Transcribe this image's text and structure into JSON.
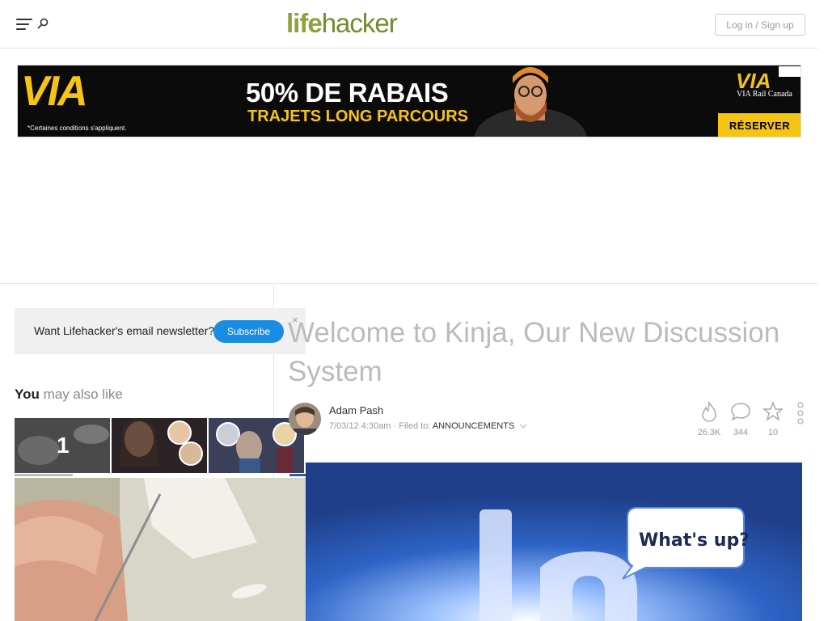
{
  "header": {
    "logo_life": "life",
    "logo_hacker": "hacker",
    "login_label": "Log in / Sign up",
    "icons": [
      "menu-icon",
      "search-icon"
    ]
  },
  "ad": {
    "brand": "VIA",
    "fine_print": "*Certaines conditions s'appliquent.",
    "headline": "50% DE RABAIS",
    "subheadline": "TRAJETS LONG PARCOURS",
    "brand_small": "VIA",
    "rail_text": "VIA Rail Canada",
    "cta": "RÉSERVER",
    "colors": {
      "yellow": "#f6c413",
      "black": "#0b0b0b"
    }
  },
  "newsletter": {
    "text": "Want Lifehacker's email newsletter?",
    "button": "Subscribe",
    "close": "×"
  },
  "recommendations": {
    "heading_strong": "You",
    "heading_rest": " may also like",
    "thumbs": [
      {
        "label": "1"
      },
      {
        "label": ""
      },
      {
        "label": ""
      }
    ]
  },
  "article": {
    "title": "Welcome to Kinja, Our New Discussion System",
    "author": "Adam Pash",
    "date": "7/03/12 4:30am",
    "filed_to_label": "Filed to:",
    "category": "ANNOUNCEMENTS",
    "stats": {
      "views": "26.3K",
      "comments": "344",
      "stars": "10"
    },
    "hero_bubble": "What's up?"
  },
  "colors": {
    "accent_blue": "#1a8ce3",
    "logo_green": "#8ea23a"
  }
}
